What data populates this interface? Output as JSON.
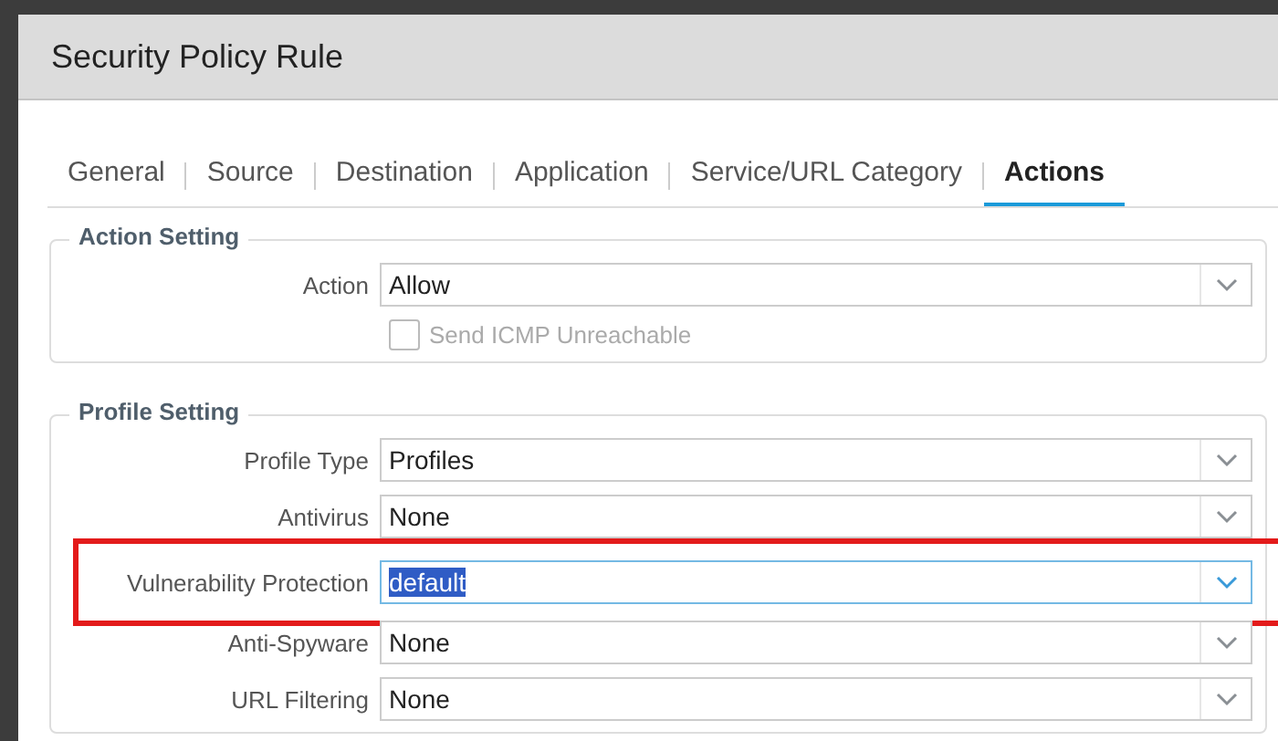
{
  "window": {
    "title": "Security Policy Rule"
  },
  "tabs": [
    {
      "label": "General",
      "selected": false
    },
    {
      "label": "Source",
      "selected": false
    },
    {
      "label": "Destination",
      "selected": false
    },
    {
      "label": "Application",
      "selected": false
    },
    {
      "label": "Service/URL Category",
      "selected": false
    },
    {
      "label": "Actions",
      "selected": true
    }
  ],
  "sections": [
    {
      "title": "Action Setting",
      "rows": [
        {
          "kind": "select",
          "label": "Action",
          "value": "Allow",
          "focused": false,
          "highlighted": false
        },
        {
          "kind": "checkbox",
          "label": "Send ICMP Unreachable",
          "checked": false,
          "disabled": true
        }
      ]
    },
    {
      "title": "Profile Setting",
      "rows": [
        {
          "kind": "select",
          "label": "Profile Type",
          "value": "Profiles",
          "focused": false,
          "highlighted": false
        },
        {
          "kind": "select",
          "label": "Antivirus",
          "value": "None",
          "focused": false,
          "highlighted": false
        },
        {
          "kind": "select",
          "label": "Vulnerability Protection",
          "value": "default",
          "focused": true,
          "highlighted": true
        },
        {
          "kind": "select",
          "label": "Anti-Spyware",
          "value": "None",
          "focused": false,
          "highlighted": false
        },
        {
          "kind": "select",
          "label": "URL Filtering",
          "value": "None",
          "focused": false,
          "highlighted": false
        }
      ]
    }
  ]
}
